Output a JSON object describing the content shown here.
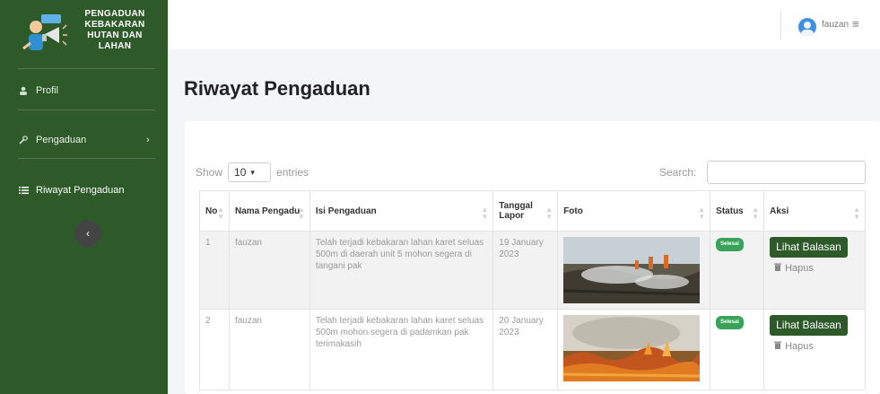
{
  "brand": {
    "line1": "PENGADUAN",
    "line2": "KEBAKARAN",
    "line3": "HUTAN DAN",
    "line4": "LAHAN"
  },
  "sidebar": {
    "items": [
      {
        "label": "Profil",
        "icon": "user-icon"
      },
      {
        "label": "Pengaduan",
        "icon": "wrench-icon"
      },
      {
        "label": "Riwayat Pengaduan",
        "icon": "list-icon"
      }
    ]
  },
  "topbar": {
    "user_name": "fauzan"
  },
  "page": {
    "title": "Riwayat Pengaduan"
  },
  "table_controls": {
    "show_label": "Show",
    "entries_value": "10",
    "entries_label": "entries",
    "search_label": "Search:"
  },
  "table": {
    "headers": [
      "No",
      "Nama Pengadu",
      "Isi Pengaduan",
      "Tanggal Lapor",
      "Foto",
      "Status",
      "Aksi"
    ],
    "rows": [
      {
        "no": "1",
        "nama": "fauzan",
        "isi": "Telah terjadi kebakaran lahan karet seluas 500m di daerah unit 5 mohon segera di tangani pak",
        "tanggal": "19 January 2023",
        "status": "Selesai",
        "reply": "Lihat Balasan",
        "delete": "Hapus"
      },
      {
        "no": "2",
        "nama": "fauzan",
        "isi": "Telah terjadi kebakaran lahan karet seluas 500m mohon segera di padamkan pak terimakasih",
        "tanggal": "20 January 2023",
        "status": "Selesai",
        "reply": "Lihat Balasan",
        "delete": "Hapus"
      }
    ]
  },
  "colors": {
    "sidebar": "#2e5a2a",
    "accent": "#2e5a2a",
    "badge": "#3aa35a"
  }
}
